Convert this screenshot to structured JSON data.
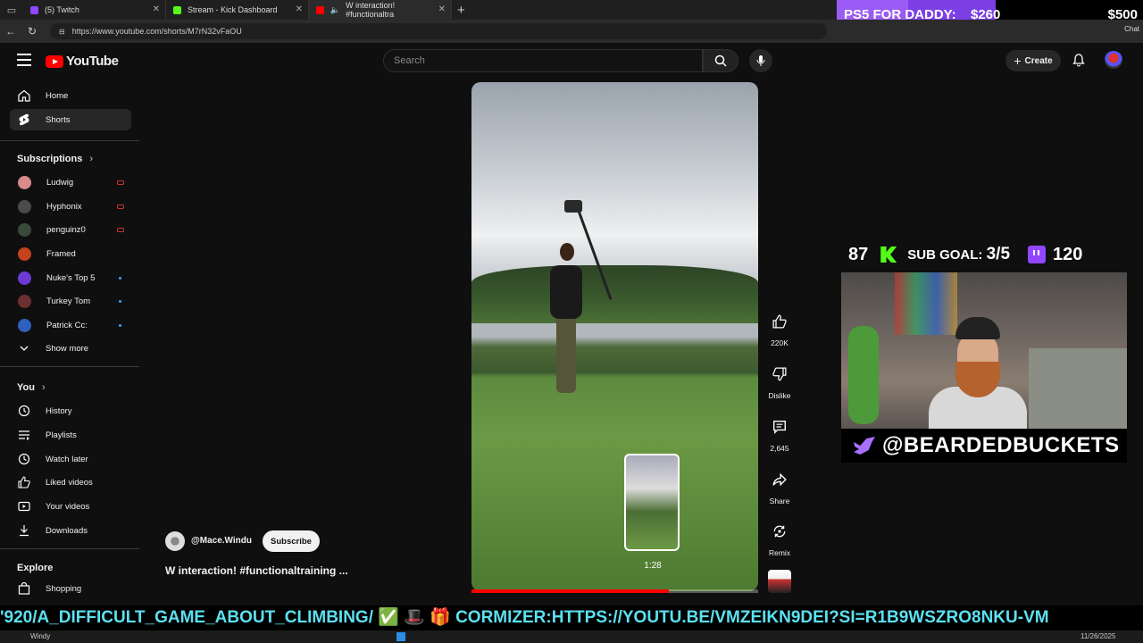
{
  "browser": {
    "tabs": [
      {
        "title": "(5) Twitch",
        "color": "#9146ff"
      },
      {
        "title": "Stream - Kick Dashboard",
        "color": "#53fc18"
      },
      {
        "title": "W interaction! #functionaltra",
        "color": "#ff0000"
      }
    ],
    "url": "https://www.youtube.com/shorts/M7rN32vFaOU",
    "chat_label": "Chat"
  },
  "donation": {
    "label": "PS5 FOR DADDY:",
    "current": "$260",
    "goal": "$500",
    "progress_fraction": 0.52
  },
  "header": {
    "logo_text": "YouTube",
    "search_placeholder": "Search",
    "create_label": "Create"
  },
  "sidebar": {
    "main": [
      {
        "label": "Home",
        "icon": "home-icon"
      },
      {
        "label": "Shorts",
        "icon": "shorts-icon"
      }
    ],
    "subscriptions_heading": "Subscriptions",
    "subscriptions": [
      {
        "label": "Ludwig",
        "status": "live",
        "color": "#d98a8a"
      },
      {
        "label": "Hyphonix",
        "status": "live",
        "color": "#4a4a4a"
      },
      {
        "label": "penguinz0",
        "status": "live",
        "color": "#3a4a3a"
      },
      {
        "label": "Framed",
        "status": "",
        "color": "#c4421d"
      },
      {
        "label": "Nuke's Top 5",
        "status": "new",
        "color": "#6d3ad6"
      },
      {
        "label": "Turkey Tom",
        "status": "new",
        "color": "#6b2f2f"
      },
      {
        "label": "Patrick Cc:",
        "status": "new",
        "color": "#2f5fbf"
      }
    ],
    "show_more": "Show more",
    "you_heading": "You",
    "you_items": [
      {
        "label": "History",
        "icon": "history-icon"
      },
      {
        "label": "Playlists",
        "icon": "playlists-icon"
      },
      {
        "label": "Watch later",
        "icon": "watch-later-icon"
      },
      {
        "label": "Liked videos",
        "icon": "like-icon"
      },
      {
        "label": "Your videos",
        "icon": "your-videos-icon"
      },
      {
        "label": "Downloads",
        "icon": "download-icon"
      }
    ],
    "explore_heading": "Explore",
    "explore_items": [
      {
        "label": "Shopping",
        "icon": "shopping-icon"
      }
    ]
  },
  "video": {
    "channel": "@Mace.Windu",
    "subscribe_label": "Subscribe",
    "title": "W interaction! #functionaltraining ...",
    "preview_time": "1:28",
    "progress_fraction": 0.69
  },
  "actions": {
    "likes": "220K",
    "dislike": "Dislike",
    "comments": "2,645",
    "share": "Share",
    "remix": "Remix"
  },
  "stream": {
    "kick_count": "87",
    "sub_goal_label": "SUB GOAL:",
    "sub_goal_value": "3/5",
    "twitch_count": "120",
    "handle": "@BEARDEDBUCKETS"
  },
  "ticker": {
    "text": "'920/A_DIFFICULT_GAME_ABOUT_CLIMBING/ ✅ 🎩 🎁 CORMIZER:HTTPS://YOUTU.BE/VMZEIKN9DEI?SI=R1B9WSZRO8NKU-VM"
  },
  "taskbar": {
    "weather": "Windy",
    "date": "11/26/2025"
  }
}
